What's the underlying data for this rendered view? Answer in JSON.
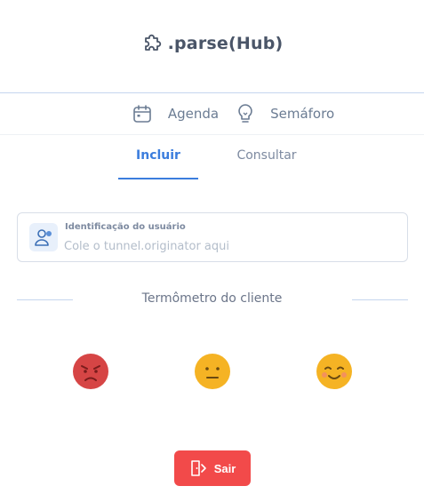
{
  "app": {
    "title": ".parse(Hub)",
    "logo_icon": "puzzle-icon"
  },
  "topnav": {
    "items": [
      {
        "label": "Agenda",
        "icon": "calendar-icon"
      },
      {
        "label": "Semáforo",
        "icon": "lightbulb-icon"
      }
    ]
  },
  "tabs": [
    {
      "label": "Incluir",
      "active": true
    },
    {
      "label": "Consultar",
      "active": false
    }
  ],
  "user_field": {
    "label": "Identificação do usuário",
    "placeholder": "Cole o tunnel.originator aqui",
    "value": "",
    "icon": "user-icon"
  },
  "thermometer": {
    "title": "Termômetro do cliente",
    "faces": [
      {
        "mood": "angry",
        "icon": "angry-face-icon",
        "color": "#d64545"
      },
      {
        "mood": "neutral",
        "icon": "neutral-face-icon",
        "color": "#f5b324"
      },
      {
        "mood": "happy",
        "icon": "happy-face-icon",
        "color": "#f5b324"
      }
    ]
  },
  "exit_button": {
    "label": "Sair",
    "icon": "door-exit-icon",
    "color": "#f24a4a"
  },
  "colors": {
    "accent": "#3b7ddd",
    "text": "#4a5568",
    "muted": "#7d8aa0"
  }
}
